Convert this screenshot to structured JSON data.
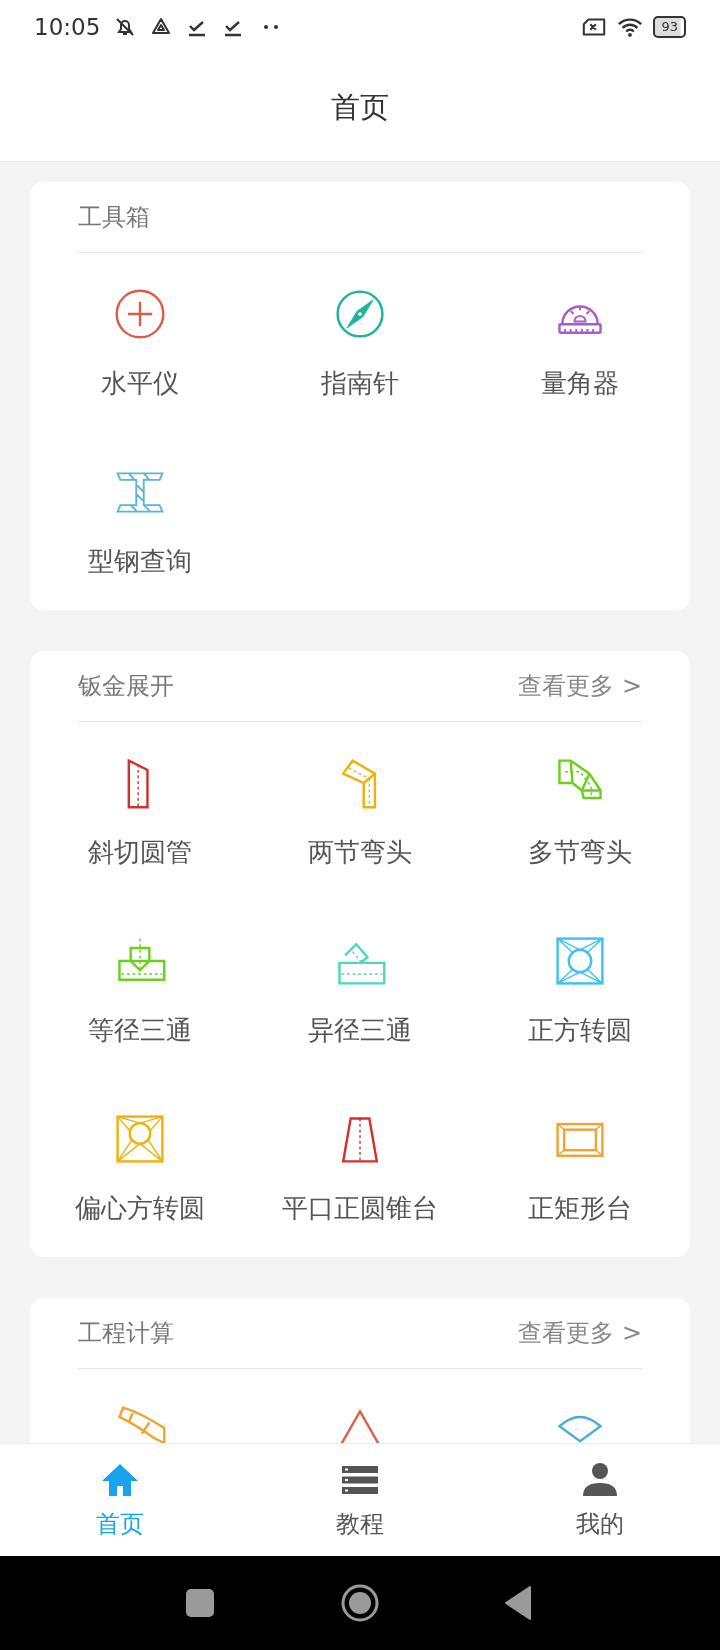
{
  "status_bar": {
    "time": "10:05",
    "battery": "93"
  },
  "title": "首页",
  "sections": [
    {
      "title": "工具箱",
      "items": [
        {
          "label": "水平仪",
          "kind": "level",
          "color": "#e05a48"
        },
        {
          "label": "指南针",
          "kind": "compass",
          "color": "#1fb39a"
        },
        {
          "label": "量角器",
          "kind": "protractor",
          "color": "#a95cc4"
        },
        {
          "label": "型钢查询",
          "kind": "ibeam",
          "color": "#5ab4e0"
        }
      ]
    },
    {
      "title": "钣金展开",
      "more": "查看更多 >",
      "items": [
        {
          "label": "斜切圆管",
          "kind": "bevel",
          "color": "#d6302e"
        },
        {
          "label": "两节弯头",
          "kind": "elbow2",
          "color": "#f0b20a"
        },
        {
          "label": "多节弯头",
          "kind": "elbowN",
          "color": "#6ccf1e"
        },
        {
          "label": "等径三通",
          "kind": "tee",
          "color": "#6ccf1e"
        },
        {
          "label": "异径三通",
          "kind": "tee2",
          "color": "#4fd6bd"
        },
        {
          "label": "正方转圆",
          "kind": "sqround",
          "color": "#3ec0f5"
        },
        {
          "label": "偏心方转圆",
          "kind": "sqround2",
          "color": "#f0b20a"
        },
        {
          "label": "平口正圆锥台",
          "kind": "cone",
          "color": "#d6302e"
        },
        {
          "label": "正矩形台",
          "kind": "rectfr",
          "color": "#f0a432"
        }
      ]
    },
    {
      "title": "工程计算",
      "more": "查看更多 >",
      "items": [
        {
          "kind": "arc",
          "color": "#f0a432"
        },
        {
          "kind": "triangle",
          "color": "#e0604a"
        },
        {
          "kind": "sector",
          "color": "#4aaed4"
        }
      ]
    }
  ],
  "tabs": [
    {
      "label": "首页",
      "kind": "home",
      "selected": true
    },
    {
      "label": "教程",
      "kind": "list",
      "selected": false
    },
    {
      "label": "我的",
      "kind": "person",
      "selected": false
    }
  ]
}
